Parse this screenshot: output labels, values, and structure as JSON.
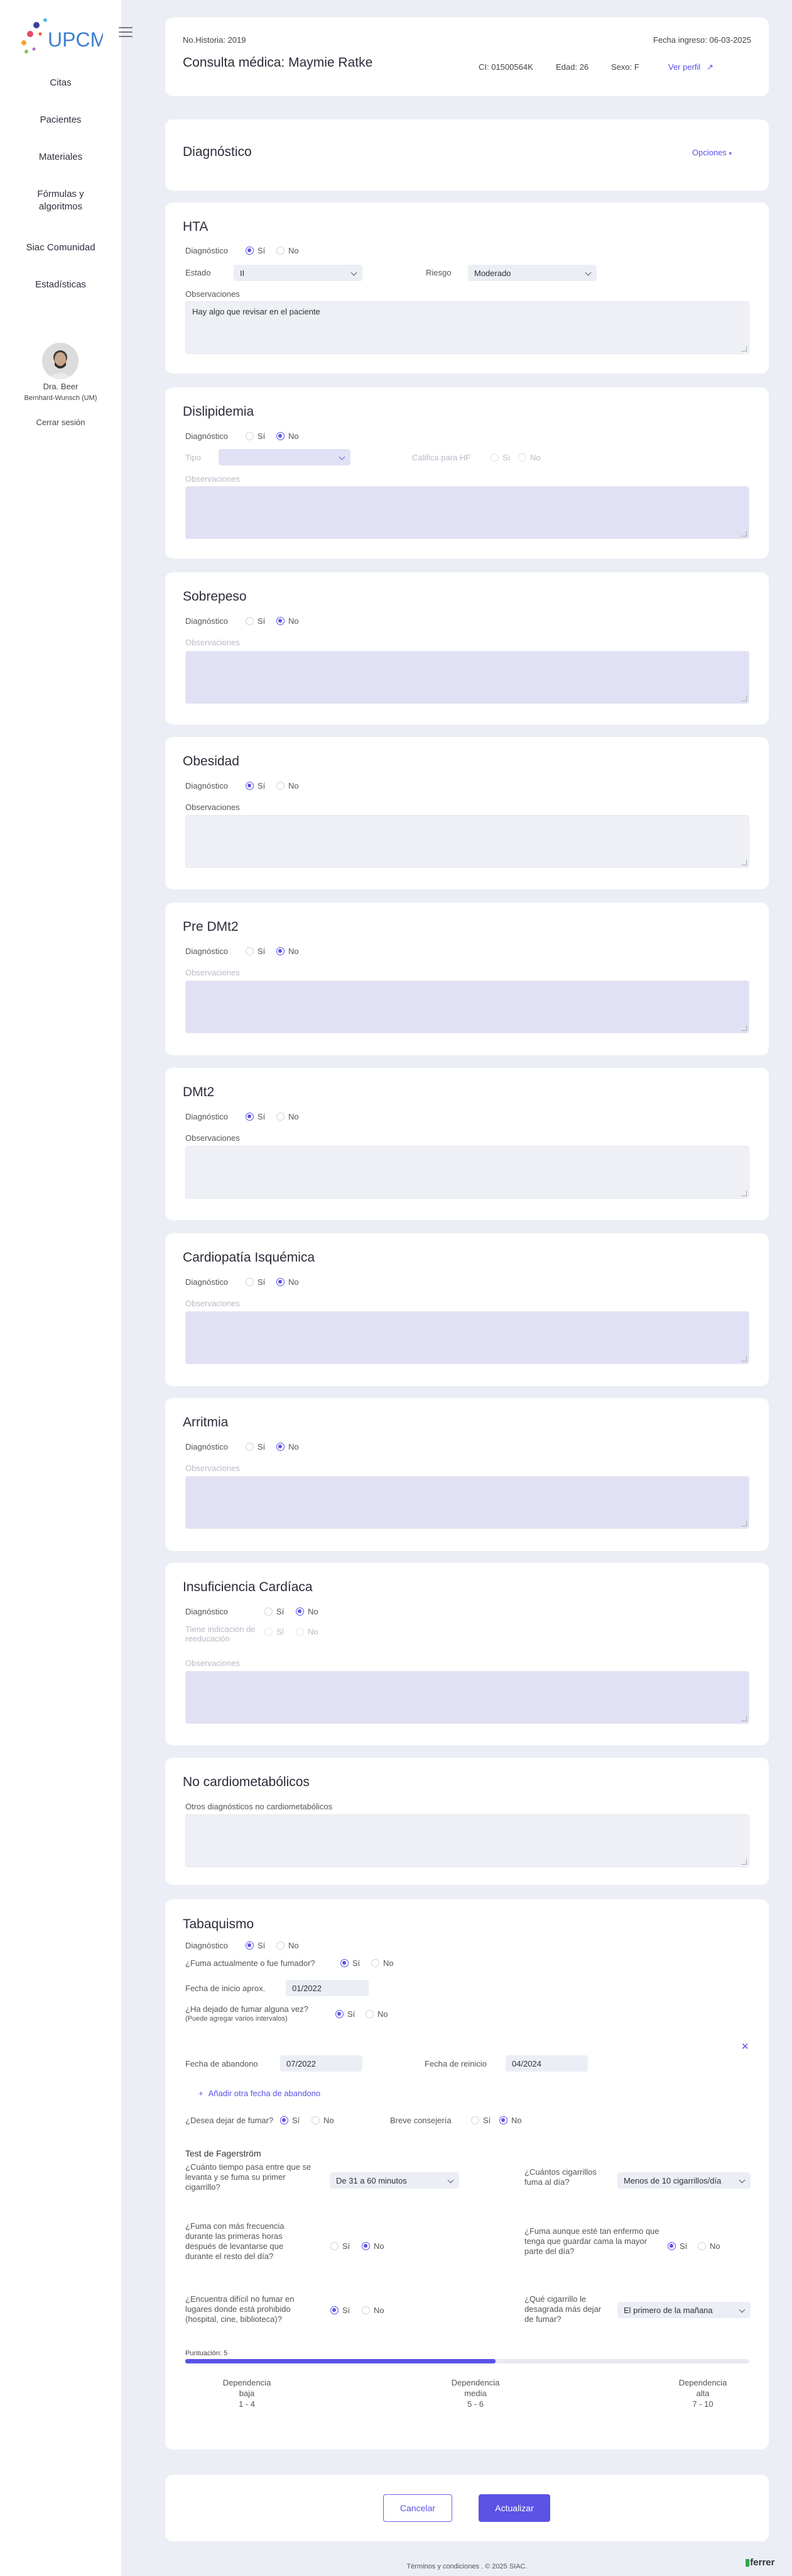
{
  "sidebar": {
    "logo_text": "UPCM",
    "nav": [
      "Citas",
      "Pacientes",
      "Materiales",
      "Fórmulas y algoritmos",
      "Siac Comunidad",
      "Estadísticas"
    ],
    "doctor_name": "Dra. Beer",
    "doctor_center": "Bernhard-Wunsch (UM)",
    "logout": "Cerrar sesión"
  },
  "header": {
    "history": "No.Historia: 2019",
    "date": "Fecha ingreso: 06-03-2025",
    "title": "Consulta médica: Maymie Ratke",
    "ci": "CI: 01500564K",
    "age": "Edad: 26",
    "sex": "Sexo: F",
    "profile_link": "Ver perfil"
  },
  "diagnostico": {
    "title": "Diagnóstico",
    "options": "Opciones"
  },
  "labels": {
    "diagnostico": "Diagnóstico",
    "si": "Sí",
    "no": "No",
    "observaciones": "Observaciones",
    "estado": "Estado",
    "riesgo": "Riesgo",
    "tipo": "Tipo",
    "califica": "Califica para HF",
    "tiene_indicacion": "Tiene indicación de reeducación",
    "otros": "Otros diagnósticos no cardiometabólicos"
  },
  "sections": {
    "hta": {
      "title": "HTA",
      "estado": "II",
      "riesgo": "Moderado",
      "obs": "Hay algo que revisar en el paciente"
    },
    "dislipidemia": {
      "title": "Dislipidemia"
    },
    "sobrepeso": {
      "title": "Sobrepeso"
    },
    "obesidad": {
      "title": "Obesidad"
    },
    "predmt2": {
      "title": "Pre DMt2"
    },
    "dmt2": {
      "title": "DMt2"
    },
    "cardiopatia": {
      "title": "Cardiopatía Isquémica"
    },
    "arritmia": {
      "title": "Arritmia"
    },
    "insuficiencia": {
      "title": "Insuficiencia Cardíaca"
    },
    "nocardio": {
      "title": "No cardiometabólicos"
    }
  },
  "tabaquismo": {
    "title": "Tabaquismo",
    "fuma_q": "¿Fuma actualmente o fue fumador?",
    "fecha_inicio_lbl": "Fecha de inicio aprox.",
    "fecha_inicio": "01/2022",
    "dejado_q": "¿Ha dejado de fumar alguna vez?",
    "dejado_hint": "(Puede agregar varios intervalos)",
    "abandono_lbl": "Fecha de abandono",
    "abandono": "07/2022",
    "reinicio_lbl": "Fecha de reinicio",
    "reinicio": "04/2024",
    "add_link": "Añadir otra fecha de abandono",
    "desea_q": "¿Desea dejar de fumar?",
    "consejeria": "Breve consejería",
    "fagerstrom": "Test de Fagerström",
    "q1": "¿Cuánto tiempo pasa entre que se levanta y se fuma su primer cigarrillo?",
    "a1": "De 31 a 60 minutos",
    "q2": "¿Cuántos cigarrillos fuma al día?",
    "a2": "Menos de 10 cigarrillos/día",
    "q3": "¿Fuma con más frecuencia durante las primeras horas después de levantarse que durante el resto del día?",
    "q4": "¿Fuma aunque esté tan enfermo que tenga que guardar cama la mayor parte del día?",
    "q5": "¿Encuentra difícil no fumar en lugares donde está prohibido (hospital, cine, biblioteca)?",
    "q6": "¿Qué cigarrillo le desagrada más dejar de fumar?",
    "a6": "El primero de la mañana",
    "score": "Puntuación: 5",
    "score_fraction": 0.55,
    "dep_low": "Dependencia baja",
    "dep_low_range": "1 - 4",
    "dep_mid": "Dependencia media",
    "dep_mid_range": "5 - 6",
    "dep_high": "Dependencia alta",
    "dep_high_range": "7 - 10"
  },
  "actions": {
    "cancel": "Cancelar",
    "update": "Actualizar"
  },
  "footer": {
    "terms": "Términos y condiciones . © 2025 SIAC.",
    "brand": "ferrer"
  },
  "colors": {
    "accent": "#5b52e6",
    "background": "#eceef6",
    "field_disabled": "#e1e1f5"
  }
}
